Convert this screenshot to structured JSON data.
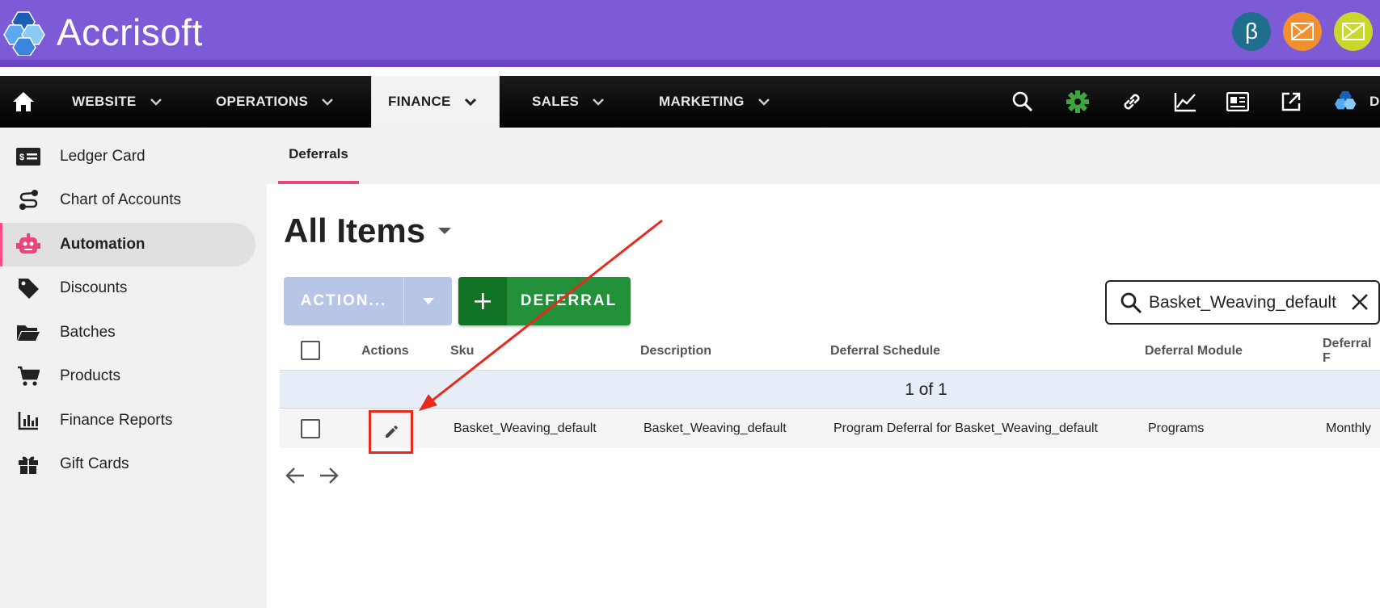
{
  "app": {
    "logo_text": "Accrisoft"
  },
  "top_icons": [
    "beta-icon",
    "mail-off-icon",
    "mail-alert-icon"
  ],
  "top_icon_labels": {
    "beta": "β"
  },
  "nav": {
    "items": [
      {
        "label": "WEBSITE"
      },
      {
        "label": "OPERATIONS"
      },
      {
        "label": "FINANCE"
      },
      {
        "label": "SALES"
      },
      {
        "label": "MARKETING"
      }
    ],
    "partial_label": "D"
  },
  "sidebar": {
    "items": [
      {
        "label": "Ledger Card"
      },
      {
        "label": "Chart of Accounts"
      },
      {
        "label": "Automation"
      },
      {
        "label": "Discounts"
      },
      {
        "label": "Batches"
      },
      {
        "label": "Products"
      },
      {
        "label": "Finance Reports"
      },
      {
        "label": "Gift Cards"
      }
    ]
  },
  "tabs": [
    {
      "label": "Deferrals"
    }
  ],
  "page": {
    "title": "All Items",
    "action_button": "ACTION...",
    "add_button": "DEFERRAL",
    "search_value": "Basket_Weaving_default"
  },
  "table": {
    "columns": [
      "Actions",
      "Sku",
      "Description",
      "Deferral Schedule",
      "Deferral Module",
      "Deferral F"
    ],
    "count_text": "1 of 1",
    "rows": [
      {
        "sku": "Basket_Weaving_default",
        "description": "Basket_Weaving_default",
        "schedule": "Program Deferral for Basket_Weaving_default",
        "module": "Programs",
        "frequency": "Monthly"
      }
    ]
  },
  "colors": {
    "header_purple": "#7e5bd6",
    "active_accent": "#e8467c",
    "add_green": "#23913a",
    "annotation_red": "#e8291c"
  }
}
